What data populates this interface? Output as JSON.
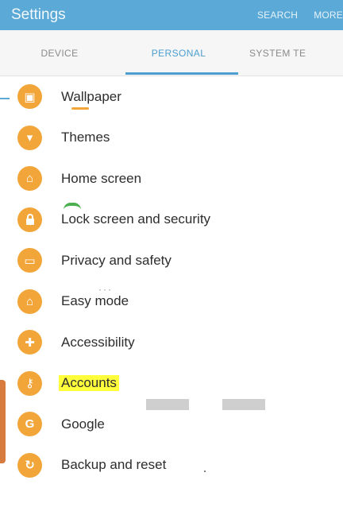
{
  "app_bar": {
    "title": "Settings",
    "actions": {
      "search": "SEARCH",
      "more": "MORE"
    }
  },
  "tabs": [
    {
      "label": "DEVICE",
      "active": false
    },
    {
      "label": "PERSONAL",
      "active": true
    },
    {
      "label": "SYSTEM TE",
      "active": false
    }
  ],
  "list": {
    "items": [
      {
        "label": "Wallpaper",
        "icon": "wallpaper-icon",
        "glyph": "▣"
      },
      {
        "label": "Themes",
        "icon": "themes-icon",
        "glyph": "▾"
      },
      {
        "label": "Home screen",
        "icon": "home-icon",
        "glyph": "⌂"
      },
      {
        "label": "Lock screen and security",
        "icon": "lock-icon",
        "glyph": "🔒"
      },
      {
        "label": "Privacy and safety",
        "icon": "privacy-icon",
        "glyph": "▭"
      },
      {
        "label": "Easy mode",
        "icon": "easy-mode-icon",
        "glyph": "⌂"
      },
      {
        "label": "Accessibility",
        "icon": "accessibility-icon",
        "glyph": "✚"
      },
      {
        "label": "Accounts",
        "icon": "key-icon",
        "glyph": "⚷",
        "highlighted": true
      },
      {
        "label": "Google",
        "icon": "google-icon",
        "glyph": "G"
      },
      {
        "label": "Backup and reset",
        "icon": "backup-icon",
        "glyph": "↻"
      }
    ]
  },
  "colors": {
    "app_bar": "#5aa9d6",
    "accent": "#4c9fd0",
    "icon_bg": "#f2a63a",
    "highlight": "#ffff3b"
  }
}
